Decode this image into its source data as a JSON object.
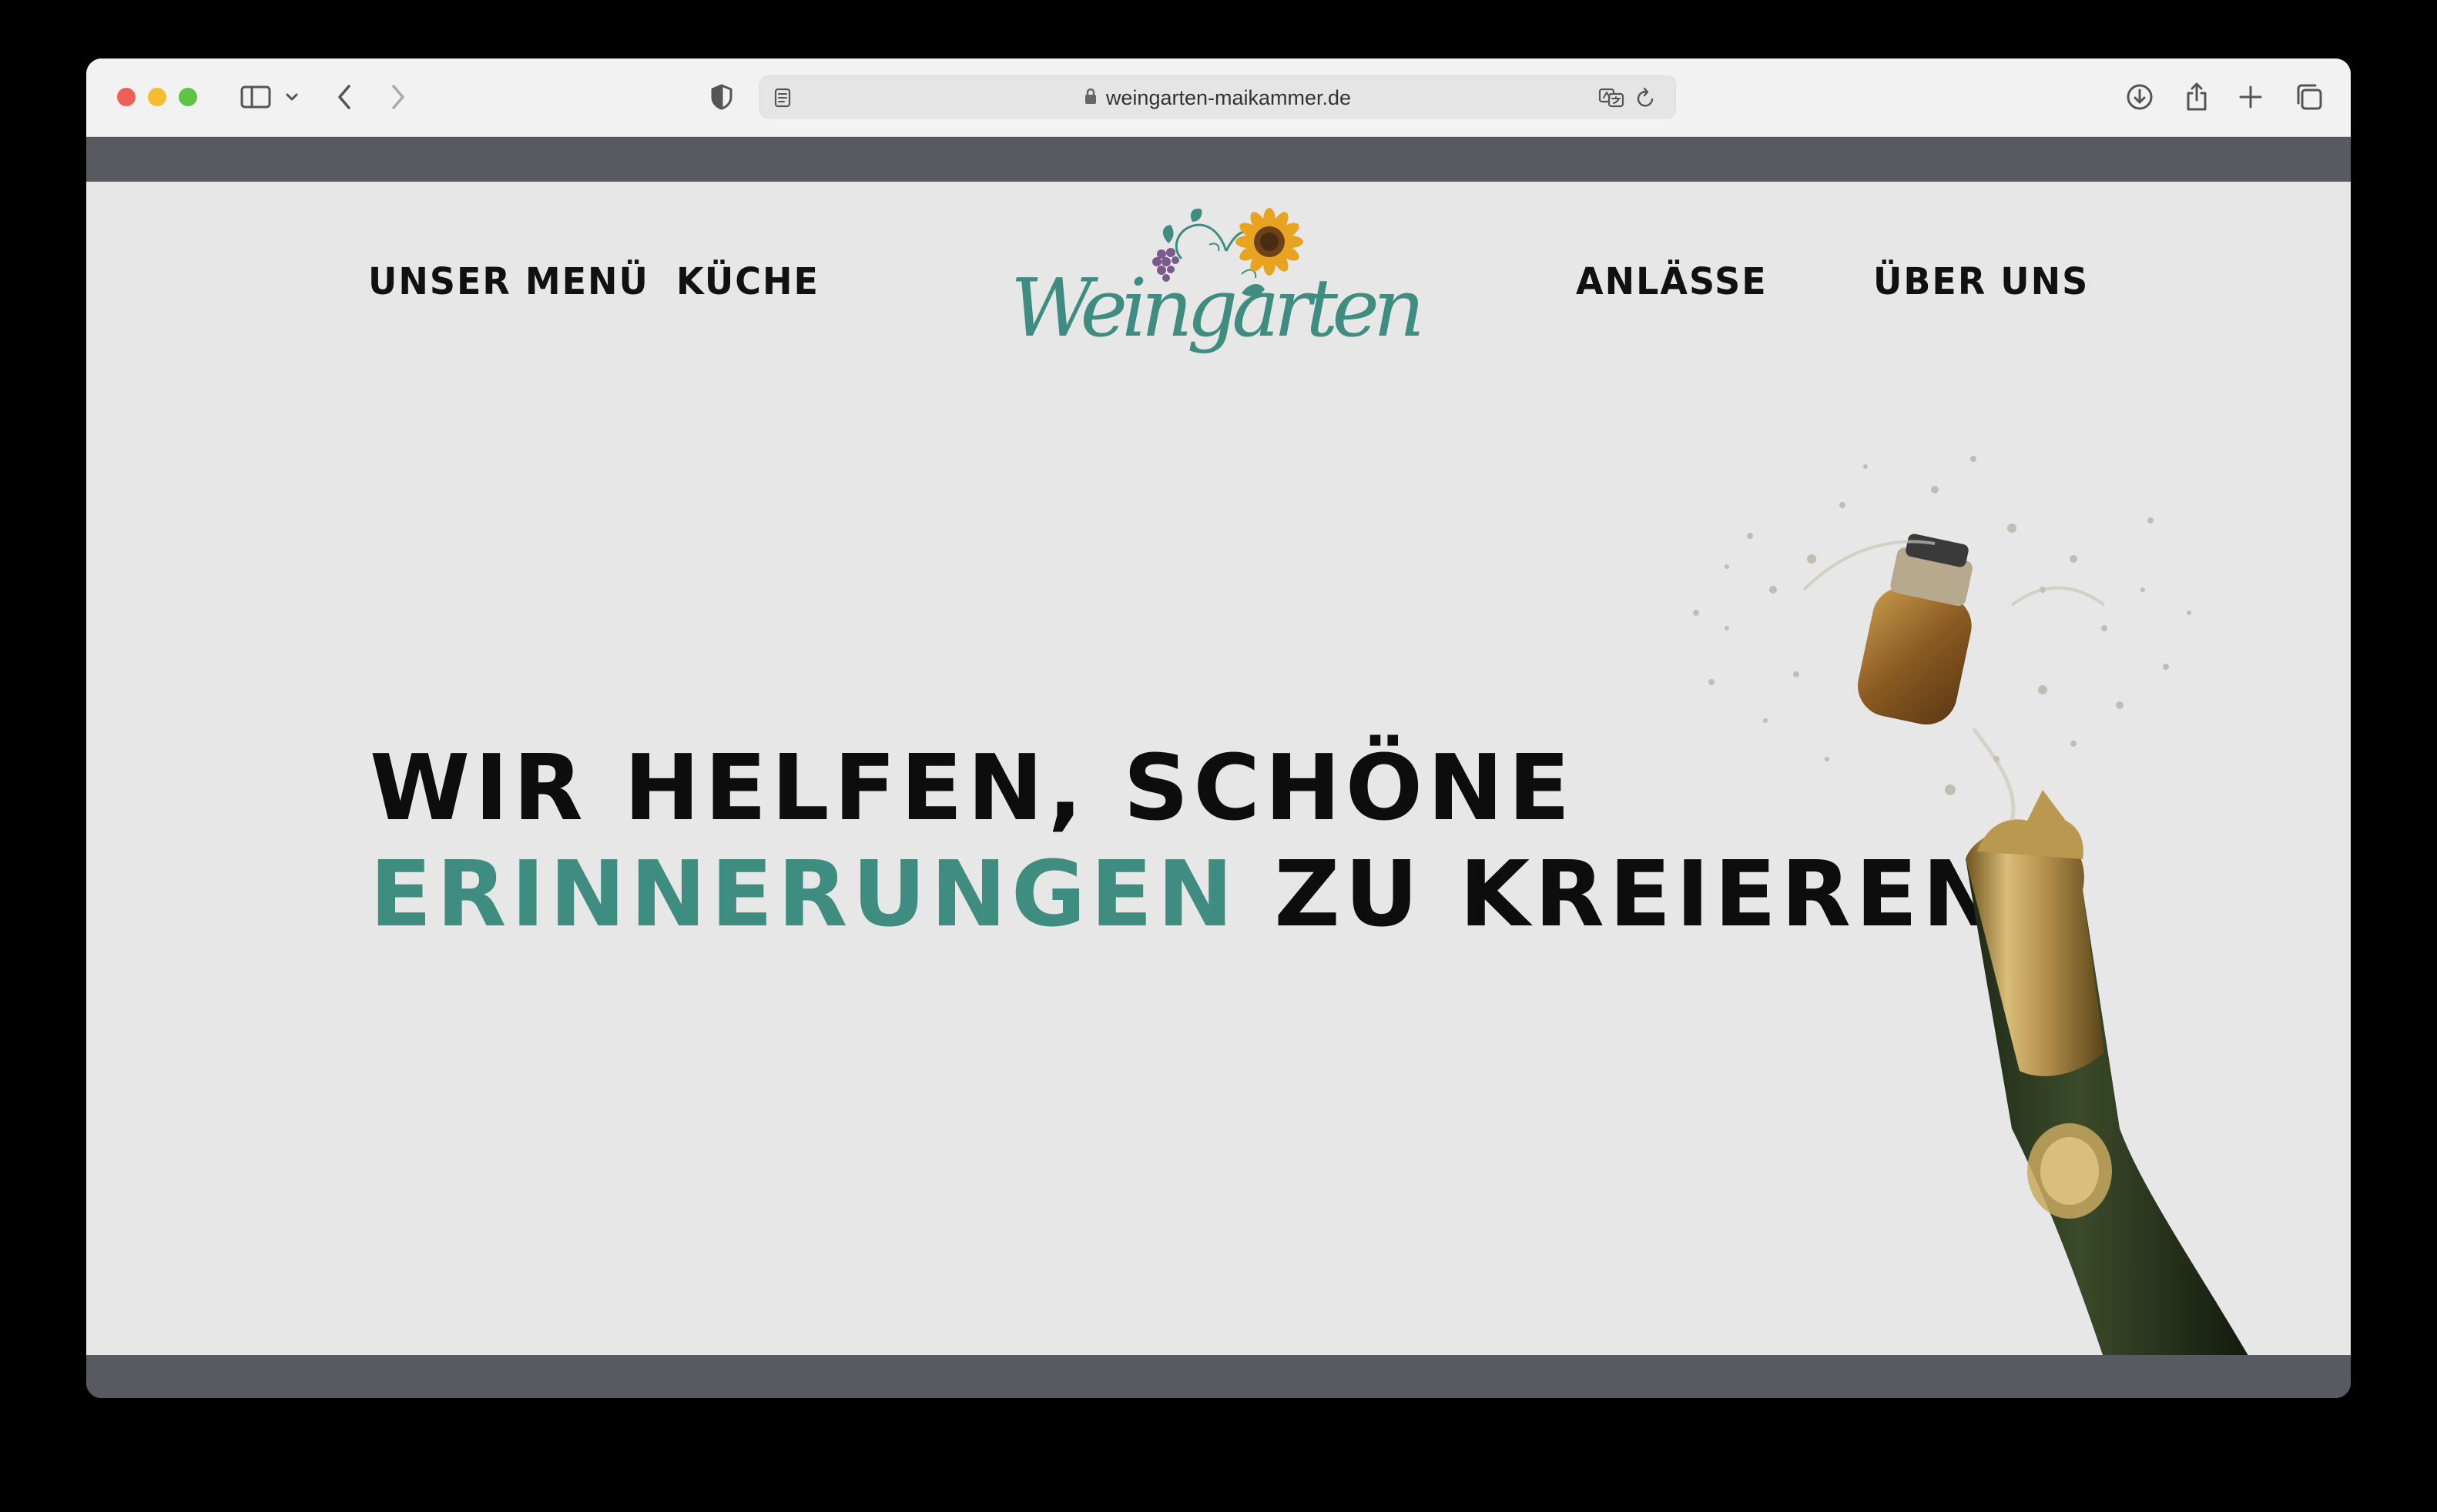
{
  "browser": {
    "url": "weingarten-maikammer.de"
  },
  "nav": {
    "left": [
      "UNSER MENÜ",
      "KÜCHE"
    ],
    "right": [
      "ANLÄSSE",
      "ÜBER UNS"
    ]
  },
  "logo": {
    "text": "Weingarten"
  },
  "hero": {
    "line1": "WIR HELFEN, SCHÖNE",
    "line2_accent": "ERINNERUNGEN",
    "line2_rest": "ZU KREIEREN."
  },
  "colors": {
    "accent": "#3f8c80",
    "bars": "#575a5f",
    "background": "#e7e7e7"
  }
}
